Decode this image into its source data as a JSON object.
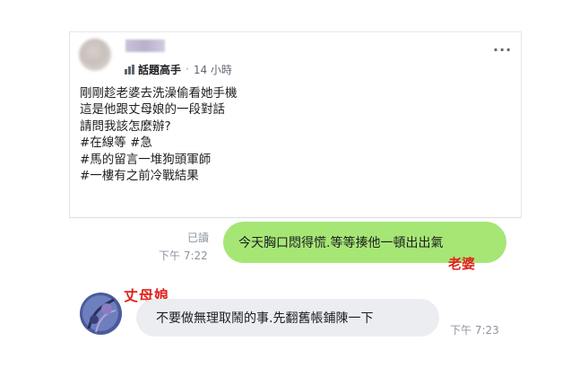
{
  "post": {
    "author_badge": "話題高手",
    "separator": "·",
    "time_ago": "14 小時",
    "more_menu": "···",
    "lines": [
      "剛剛趁老婆去洗澡偷看她手機",
      "這是他跟丈母娘的一段對話",
      "請問我該怎麼辦?",
      "#在線等 #急",
      "#馬的留言一堆狗頭軍師",
      "#一樓有之前冷戰結果"
    ]
  },
  "chat": {
    "sent": {
      "read_status": "已讀",
      "time": "下午 7:22",
      "text": "今天胸口悶得慌.等等揍他一頓出出氣",
      "annotation": "老婆"
    },
    "received": {
      "annotation": "丈母娘",
      "text": "不要做無理取鬧的事.先翻舊帳鋪陳一下",
      "time": "下午 7:23"
    }
  },
  "colors": {
    "sent_bubble": "#a6e675",
    "received_bubble": "#ebedf0",
    "annotation_red": "#e2211c"
  },
  "icons": {
    "badge": "top-fan-badge-icon",
    "more": "more-options-icon"
  }
}
